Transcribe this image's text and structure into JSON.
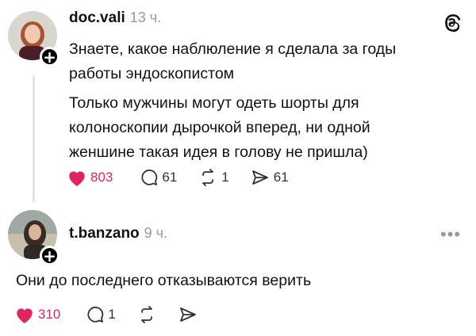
{
  "posts": [
    {
      "username": "doc.vali",
      "time": "13 ч.",
      "paragraphs": [
        "Знаете, какое наблюление я сделала за годы работы эндоскопистом",
        "Только мужчины могут одеть шорты для колоноскопии дырочкой вперед, ни одной женшине такая идея в голову не пришла)"
      ],
      "likes": "803",
      "comments": "61",
      "reposts": "1",
      "shares": "61"
    },
    {
      "username": "t.banzano",
      "time": "9 ч.",
      "text": "Они до последнего отказываются верить",
      "likes": "310",
      "comments": "1"
    }
  ],
  "icons": {
    "app_logo": "threads-icon",
    "more": "more-icon",
    "follow": "plus-icon"
  },
  "colors": {
    "like": "#e0245e",
    "muted": "#999999"
  }
}
